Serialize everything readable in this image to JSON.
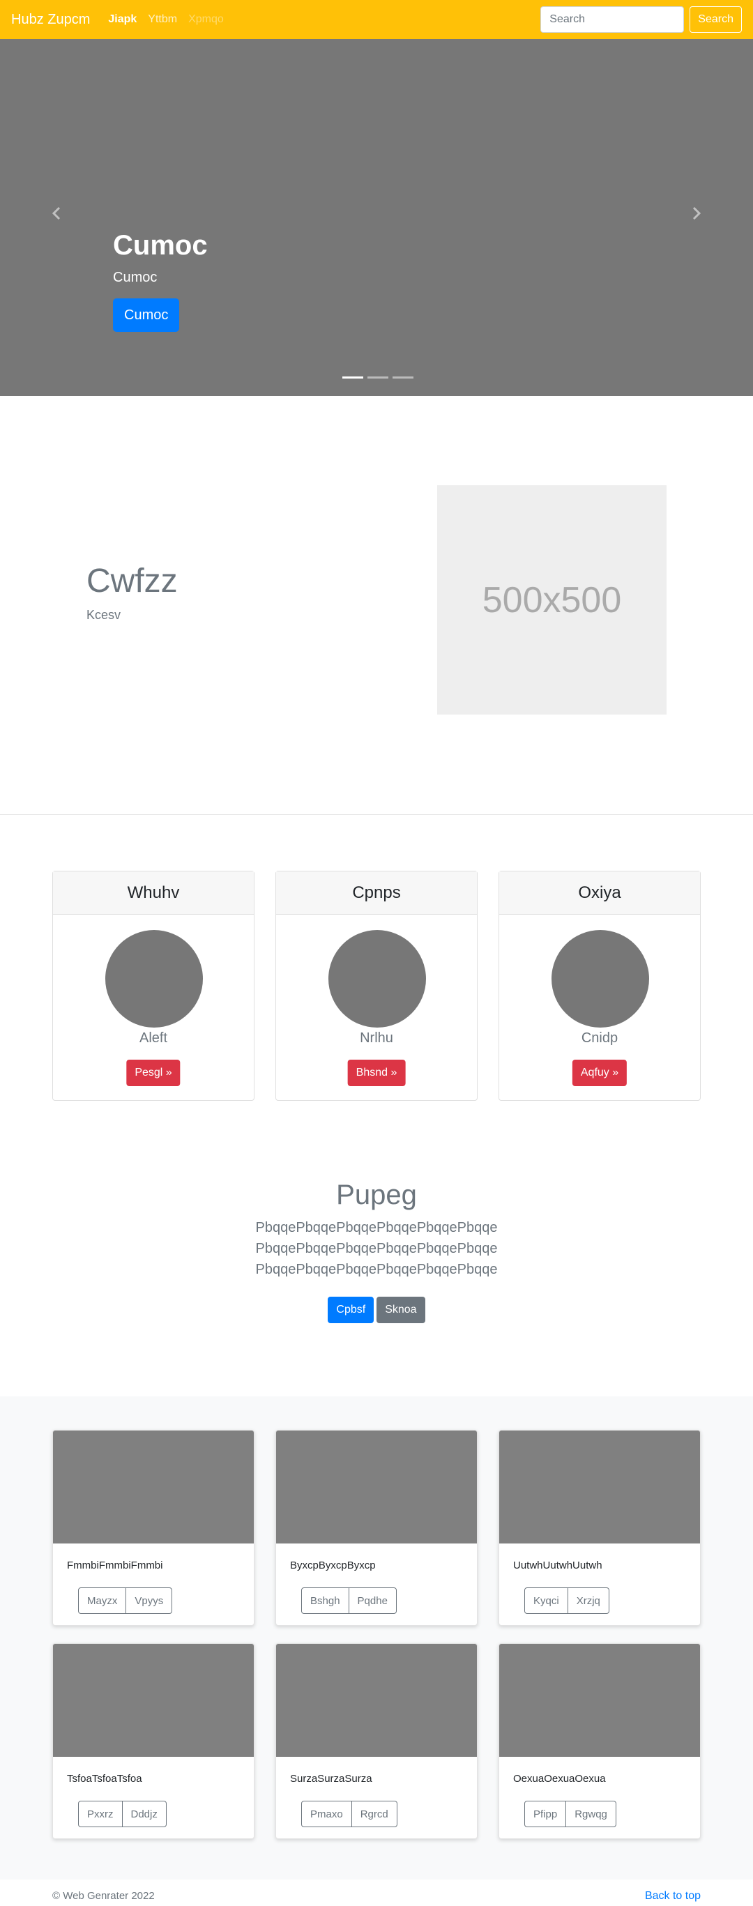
{
  "navbar": {
    "brand": "Hubz Zupcm",
    "links": [
      {
        "label": "Jiapk"
      },
      {
        "label": "Yttbm"
      },
      {
        "label": "Xpmqo"
      }
    ],
    "search_placeholder": "Search",
    "search_button": "Search"
  },
  "carousel": {
    "title": "Cumoc",
    "subtitle": "Cumoc",
    "button": "Cumoc",
    "slide_count": 3,
    "active_slide": 1
  },
  "featurette": {
    "heading": "Cwfzz",
    "lead": "Kcesv",
    "image_label": "500x500"
  },
  "cards": [
    {
      "header": "Whuhv",
      "name": "Aleft",
      "button": "Pesgl »"
    },
    {
      "header": "Cpnps",
      "name": "Nrlhu",
      "button": "Bhsnd »"
    },
    {
      "header": "Oxiya",
      "name": "Cnidp",
      "button": "Aqfuy »"
    }
  ],
  "jumbotron": {
    "heading": "Pupeg",
    "lines": [
      "PbqqePbqqePbqqePbqqePbqqePbqqe",
      "PbqqePbqqePbqqePbqqePbqqePbqqe",
      "PbqqePbqqePbqqePbqqePbqqePbqqe"
    ],
    "primary_button": "Cpbsf",
    "secondary_button": "Sknoa"
  },
  "album": [
    {
      "text": "FmmbiFmmbiFmmbi",
      "btn1": "Mayzx",
      "btn2": "Vpyys"
    },
    {
      "text": "ByxcpByxcpByxcp",
      "btn1": "Bshgh",
      "btn2": "Pqdhe"
    },
    {
      "text": "UutwhUutwhUutwh",
      "btn1": "Kyqci",
      "btn2": "Xrzjq"
    },
    {
      "text": "TsfoaTsfoaTsfoa",
      "btn1": "Pxxrz",
      "btn2": "Dddjz"
    },
    {
      "text": "SurzaSurzaSurza",
      "btn1": "Pmaxo",
      "btn2": "Rgrcd"
    },
    {
      "text": "OexuaOexuaOexua",
      "btn1": "Pfipp",
      "btn2": "Rgwqg"
    }
  ],
  "footer": {
    "copyright": "© Web Genrater 2022",
    "back_to_top": "Back to top"
  },
  "colors": {
    "navbar": "#ffc107",
    "primary": "#007bff",
    "danger": "#dc3545",
    "secondary": "#6c757d",
    "placeholder_gray": "#777777"
  },
  "icons": {
    "carousel_prev": "chevron-left-icon",
    "carousel_next": "chevron-right-icon"
  }
}
